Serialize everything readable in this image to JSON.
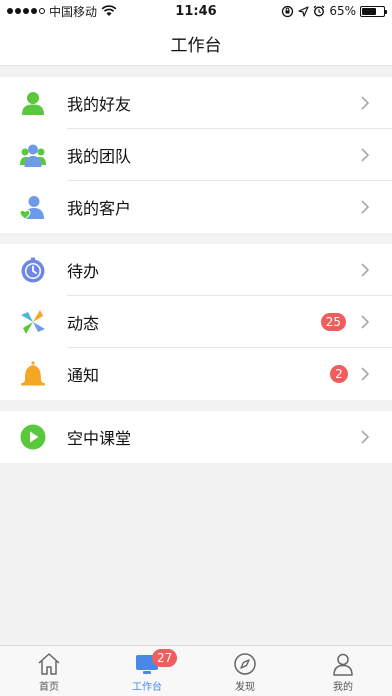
{
  "status_bar": {
    "carrier": "中国移动",
    "time": "11:46",
    "battery": "65%",
    "battery_level": 0.65
  },
  "header": {
    "title": "工作台"
  },
  "groups": [
    {
      "items": [
        {
          "label": "我的好友",
          "icon": "person-icon",
          "icon_color": "#5ac83c"
        },
        {
          "label": "我的团队",
          "icon": "team-icon",
          "icon_color": "#6e9be8"
        },
        {
          "label": "我的客户",
          "icon": "client-icon",
          "icon_color": "#6e9be8"
        }
      ]
    },
    {
      "items": [
        {
          "label": "待办",
          "icon": "stopwatch-icon",
          "icon_color": "#6e87e8"
        },
        {
          "label": "动态",
          "icon": "pinwheel-icon",
          "badge": "25"
        },
        {
          "label": "通知",
          "icon": "bell-icon",
          "icon_color": "#f5a623",
          "badge": "2"
        }
      ]
    },
    {
      "items": [
        {
          "label": "空中课堂",
          "icon": "play-icon",
          "icon_color": "#5ac83c"
        }
      ]
    }
  ],
  "tab_bar": {
    "tabs": [
      {
        "label": "首页",
        "icon": "home-icon"
      },
      {
        "label": "工作台",
        "icon": "workbench-icon",
        "badge": "27",
        "active": true
      },
      {
        "label": "发现",
        "icon": "compass-icon"
      },
      {
        "label": "我的",
        "icon": "profile-icon"
      }
    ]
  },
  "colors": {
    "accent": "#4a88e8",
    "badge": "#f15c5c",
    "background": "#f2f2f2"
  }
}
